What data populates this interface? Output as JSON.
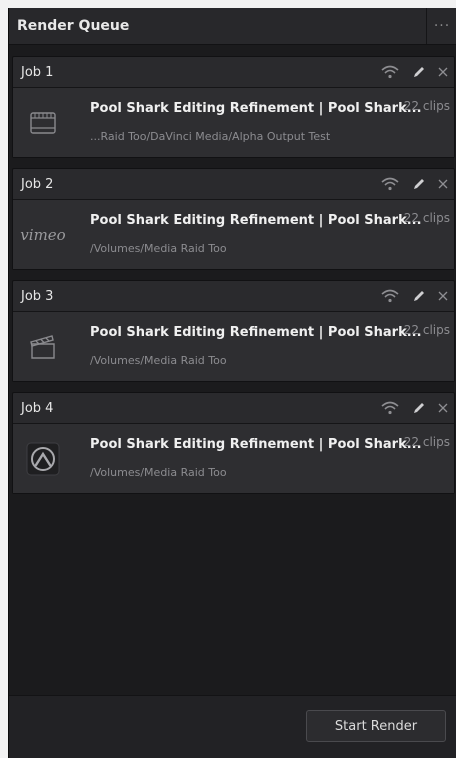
{
  "panel": {
    "title": "Render Queue",
    "menu_icon": "more-dots-icon"
  },
  "jobs": [
    {
      "label": "Job 1",
      "title": "Pool Shark Editing Refinement | Pool Shark...",
      "clips": "22 clips",
      "path": "...Raid Too/DaVinci Media/Alpha Output Test",
      "thumb_icon": "film-frame-icon"
    },
    {
      "label": "Job 2",
      "title": "Pool Shark Editing Refinement | Pool Shark...",
      "clips": "22 clips",
      "path": "/Volumes/Media Raid Too",
      "thumb_text": "vimeo"
    },
    {
      "label": "Job 3",
      "title": "Pool Shark Editing Refinement | Pool Shark...",
      "clips": "22 clips",
      "path": "/Volumes/Media Raid Too",
      "thumb_icon": "clapperboard-icon"
    },
    {
      "label": "Job 4",
      "title": "Pool Shark Editing Refinement | Pool Shark...",
      "clips": "22 clips",
      "path": "/Volumes/Media Raid Too",
      "thumb_icon": "app-logo-icon"
    }
  ],
  "footer": {
    "start_render_label": "Start Render"
  }
}
